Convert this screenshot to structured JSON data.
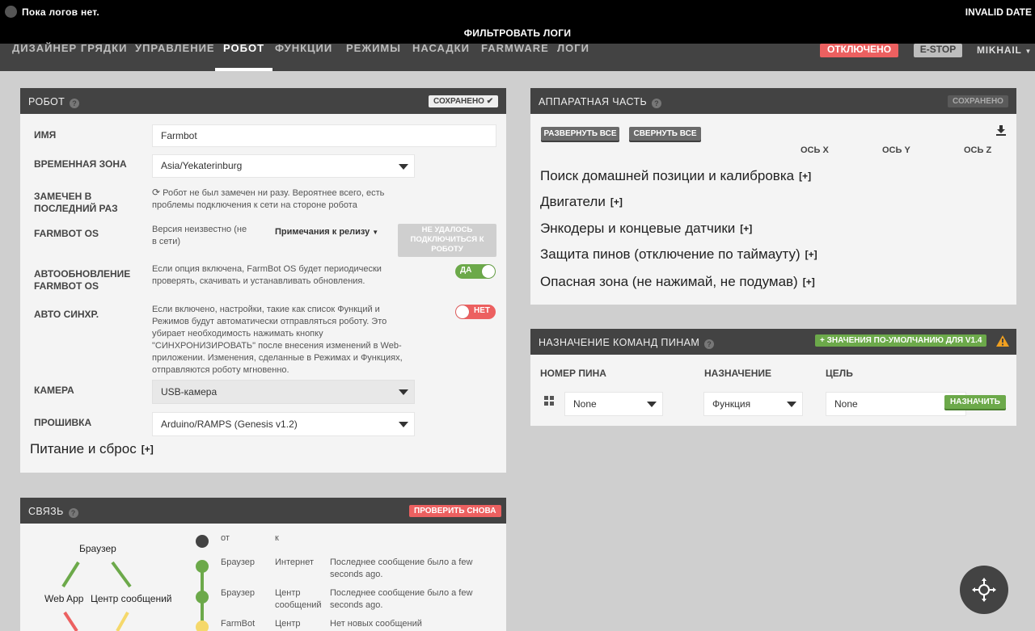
{
  "logbar": {
    "message": "Пока логов нет.",
    "date": "INVALID DATE",
    "filter_label": "ФИЛЬТРОВАТЬ ЛОГИ"
  },
  "nav": {
    "tabs": [
      "ДИЗАЙНЕР ГРЯДКИ",
      "УПРАВЛЕНИЕ",
      "РОБОТ",
      "ФУНКЦИИ",
      "РЕЖИМЫ",
      "НАСАДКИ",
      "FARMWARE",
      "ЛОГИ"
    ],
    "active_tab": "РОБОТ",
    "status_button": "ОТКЛЮЧЕНО",
    "estop_button": "E-STOP",
    "user_menu": "MIKHAIL"
  },
  "robot": {
    "title": "РОБОТ",
    "help": "?",
    "saved_button": "СОХРАНЕНО ✔",
    "name_label": "ИМЯ",
    "name_value": "Farmbot",
    "timezone_label": "ВРЕМЕННАЯ ЗОНА",
    "timezone_value": "Asia/Yekaterinburg",
    "last_seen_label_1": "ЗАМЕЧЕН В",
    "last_seen_label_2": "ПОСЛЕДНИЙ РАЗ",
    "last_seen_text_1": "Робот не был замечен ни разу. Вероятнее всего, есть",
    "last_seen_text_2": "проблемы подключения к сети на стороне робота",
    "os_label": "FARMBOT OS",
    "os_version_1": "Версия неизвестно (не",
    "os_version_2": "в сети)",
    "release_notes": "Примечания к релизу",
    "connect_fail_1": "НЕ УДАЛОСЬ",
    "connect_fail_2": "ПОДКЛЮЧИТЬСЯ К",
    "connect_fail_3": "РОБОТУ",
    "autoupdate_label_1": "АВТООБНОВЛЕНИЕ",
    "autoupdate_label_2": "FARMBOT OS",
    "autoupdate_text_1": "Если опция включена, FarmBot OS будет периодически",
    "autoupdate_text_2": "проверять, скачивать и устанавливать обновления.",
    "autoupdate_toggle": "ДА",
    "autosync_label": "АВТО СИНХР.",
    "autosync_text": [
      "Если включено, настройки, такие как список Функций и",
      "Режимов будут автоматически отправляться роботу. Это",
      "убирает необходимость нажимать кнопку",
      "\"СИНХРОНИЗИРОВАТЬ\" после внесения изменений в Web-",
      "приложении. Изменения, сделанные в Режимах и Функциях,",
      "отправляются роботу мгновенно."
    ],
    "autosync_toggle": "НЕТ",
    "camera_label": "КАМЕРА",
    "camera_value": "USB-камера",
    "firmware_label": "ПРОШИВКА",
    "firmware_value": "Arduino/RAMPS (Genesis v1.2)",
    "power_section": "Питание и сброс",
    "plus": "[+]"
  },
  "connectivity": {
    "title": "СВЯЗЬ",
    "help": "?",
    "recheck_button": "ПРОВЕРИТЬ СНОВА",
    "node_browser": "Браузер",
    "node_webapp": "Web App",
    "node_broker": "Центр сообщений",
    "col_from": "от",
    "col_to": "к",
    "rows": [
      {
        "from": "Браузер",
        "to_1": "Интернет",
        "to_2": "",
        "status_1": "Последнее сообщение было a few",
        "status_2": "seconds ago."
      },
      {
        "from": "Браузер",
        "to_1": "Центр",
        "to_2": "сообщений",
        "status_1": "Последнее сообщение было a few",
        "status_2": "seconds ago."
      },
      {
        "from": "FarmBot",
        "to_1": "Центр",
        "to_2": "",
        "status_1": "Нет новых сообщений",
        "status_2": ""
      }
    ]
  },
  "hardware": {
    "title": "АППАРАТНАЯ ЧАСТЬ",
    "help": "?",
    "saved_button": "СОХРАНЕНО",
    "expand_all": "РАЗВЕРНУТЬ ВСЕ",
    "collapse_all": "СВЕРНУТЬ ВСЕ",
    "axis_x": "ОСЬ X",
    "axis_y": "ОСЬ Y",
    "axis_z": "ОСЬ Z",
    "sections": [
      "Поиск домашней позиции и калибровка",
      "Двигатели",
      "Энкодеры и концевые датчики",
      "Защита пинов (отключение по таймауту)",
      "Опасная зона (не нажимай, не подумав)"
    ],
    "plus": "[+]"
  },
  "pin_bindings": {
    "title": "НАЗНАЧЕНИЕ КОМАНД ПИНАМ",
    "help": "?",
    "defaults_button": "+ ЗНАЧЕНИЯ ПО-УМОЛЧАНИЮ ДЛЯ V1.4",
    "col_pin": "НОМЕР ПИНА",
    "col_binding": "НАЗНАЧЕНИЕ",
    "col_target": "ЦЕЛЬ",
    "pin_value": "None",
    "binding_value": "Функция",
    "target_value": "None",
    "assign_button": "НАЗНАЧИТЬ"
  },
  "colors": {
    "dark": "#434343",
    "green": "#6ca94a",
    "red": "#ec6060",
    "yellow": "#f5d86b",
    "warning": "#f0a020"
  }
}
